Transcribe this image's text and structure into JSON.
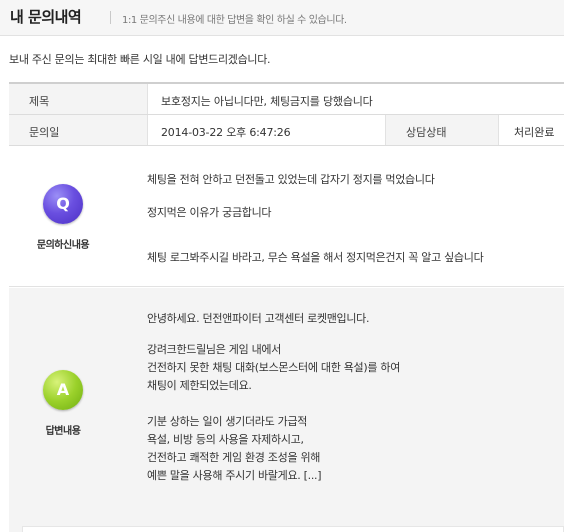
{
  "header": {
    "title": "내 문의내역",
    "subtitle": "1:1 문의주신 내용에 대한 답변을 확인 하실 수 있습니다."
  },
  "notice": "보내 주신 문의는 최대한 빠른 시일 내에 답변드리겠습니다.",
  "info": {
    "subject_label": "제목",
    "subject_value": "보호정지는 아닙니다만, 체팅금지를 당했습니다",
    "date_label": "문의일",
    "date_value": "2014-03-22 오후 6:47:26",
    "status_label": "상담상태",
    "status_value": "처리완료"
  },
  "question": {
    "badge": "Q",
    "caption": "문의하신내용",
    "lines": [
      "체팅을 전혀 안하고 던전돌고 있었는데 갑자기 정지를 먹었습니다",
      "정지먹은 이유가 궁금합니다",
      "체팅 로그봐주시길 바라고, 무슨 욕설을 해서 정지먹은건지 꼭 알고 싶습니다"
    ]
  },
  "answer": {
    "badge": "A",
    "caption": "답변내용",
    "lines": [
      "안녕하세요. 던전앤파이터 고객센터 로켓맨입니다.",
      "강려크한드릴님은 게임 내에서",
      "건전하지 못한 채팅 대화(보스몬스터에 대한 욕설)를 하여",
      "채팅이 제한되었는데요.",
      "기분 상하는 일이 생기더라도 가급적",
      "욕설, 비방 등의 사용을 자제하시고,",
      "건전하고 쾌적한 게임 환경 조성을 위해",
      "예쁜 말을 사용해 주시기 바랄게요. [...]"
    ]
  }
}
